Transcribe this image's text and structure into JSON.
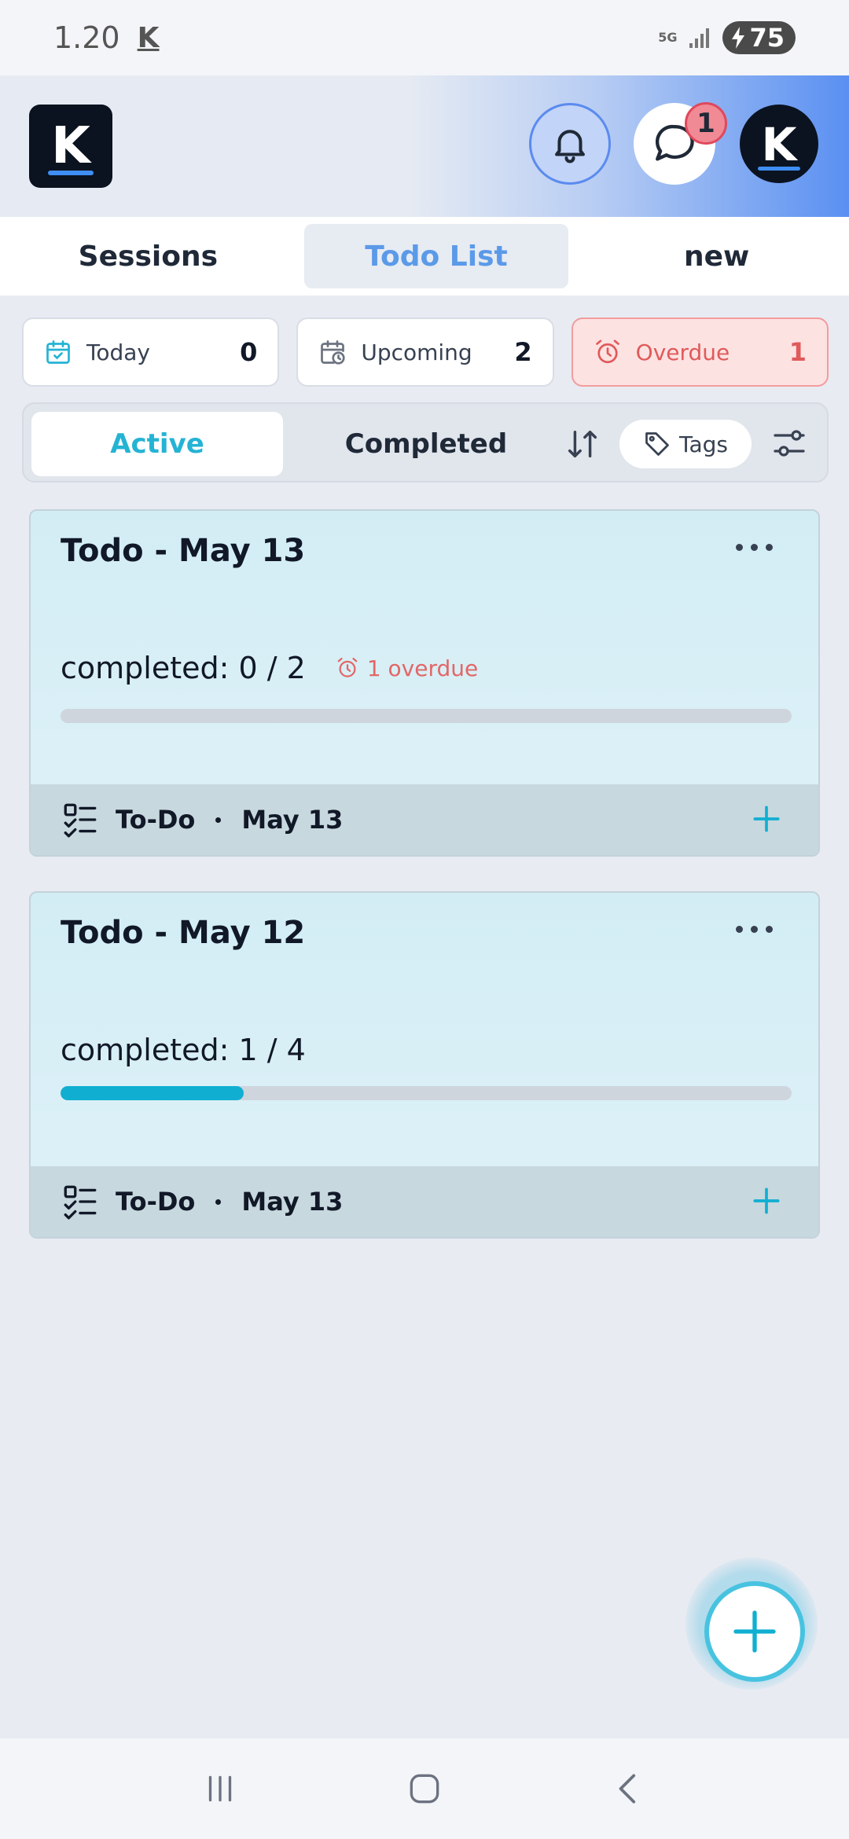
{
  "status_bar": {
    "time": "1.20",
    "app_glyph": "K",
    "network": "5G",
    "battery": "75"
  },
  "header": {
    "logo_letter": "K",
    "chat_badge": "1",
    "avatar_letter": "K"
  },
  "tabs": [
    {
      "label": "Sessions",
      "active": false
    },
    {
      "label": "Todo List",
      "active": true
    },
    {
      "label": "new",
      "active": false
    }
  ],
  "stats": {
    "today": {
      "label": "Today",
      "count": "0"
    },
    "upcoming": {
      "label": "Upcoming",
      "count": "2"
    },
    "overdue": {
      "label": "Overdue",
      "count": "1"
    }
  },
  "filter": {
    "active": "Active",
    "completed": "Completed",
    "tags": "Tags"
  },
  "cards": [
    {
      "title": "Todo - May 13",
      "progress_text": "completed: 0 / 2",
      "overdue": "1 overdue",
      "progress": 0.0,
      "footer_type": "To-Do",
      "footer_date": "May 13"
    },
    {
      "title": "Todo - May 12",
      "progress_text": "completed: 1 / 4",
      "overdue": "",
      "progress": 0.25,
      "footer_type": "To-Do",
      "footer_date": "May 13"
    }
  ],
  "colors": {
    "accent": "#10afd1",
    "overdue": "#e05a5a",
    "tab_active": "#5b9ae8"
  }
}
